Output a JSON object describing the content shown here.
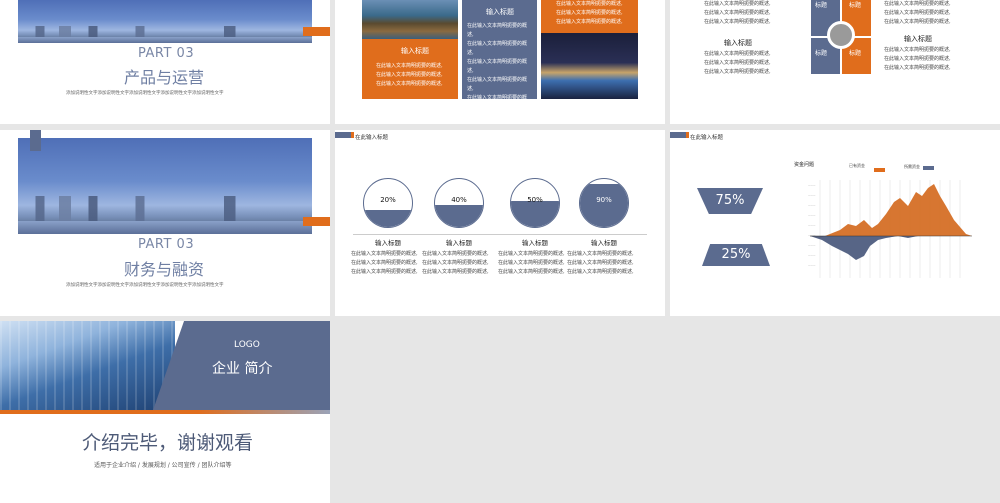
{
  "colors": {
    "navy": "#5b6b8f",
    "orange": "#e06d1c",
    "bg": "#e6e6e6"
  },
  "slide1": {
    "part": "PART 03",
    "title": "产品与运营",
    "caption": "添加说明性文字添加说明性文字添加说明性文字添加说明性文字添加说明性文字"
  },
  "slide2": {
    "box1_title": "输入标题",
    "box1_lines": [
      "在此输入文本简明扼要的概述,",
      "在此输入文本简明扼要的概述,",
      "在此输入文本简明扼要的概述,"
    ],
    "box2_title": "输入标题",
    "box2_lines": [
      "在此输入文本简明扼要的概述,",
      "在此输入文本简明扼要的概述,",
      "在此输入文本简明扼要的概述,",
      "在此输入文本简明扼要的概述,",
      "在此输入文本简明扼要的概述,",
      "在此输入文本简明扼要的概述,"
    ],
    "box3_lines": [
      "在此输入文本简明扼要的概述,",
      "在此输入文本简明扼要的概述,",
      "在此输入文本简明扼要的概述,"
    ]
  },
  "slide3": {
    "top_lines_left": [
      "在此输入文本简明扼要的概述,",
      "在此输入文本简明扼要的概述,",
      "在此输入文本简明扼要的概述,"
    ],
    "top_lines_right": [
      "在此输入文本简明扼要的概述,",
      "在此输入文本简明扼要的概述,",
      "在此输入文本简明扼要的概述,"
    ],
    "left_heading": "输入标题",
    "left_lines": [
      "在此输入文本简明扼要的概述,",
      "在此输入文本简明扼要的概述,",
      "在此输入文本简明扼要的概述,"
    ],
    "right_heading": "输入标题",
    "right_lines": [
      "在此输入文本简明扼要的概述,",
      "在此输入文本简明扼要的概述,",
      "在此输入文本简明扼要的概述,"
    ],
    "quad_labels": [
      "标题",
      "标题",
      "标题",
      "标题"
    ]
  },
  "slide4": {
    "part": "PART 03",
    "title": "财务与融资",
    "caption": "添加说明性文字添加说明性文字添加说明性文字添加说明性文字添加说明性文字"
  },
  "slide5": {
    "header": "在此输入标题",
    "items": [
      {
        "percent": "20%",
        "fill": 0.35,
        "heading": "输入标题",
        "lines": [
          "在此输入文本简明扼要的概述,",
          "在此输入文本简明扼要的概述,",
          "在此输入文本简明扼要的概述,"
        ]
      },
      {
        "percent": "40%",
        "fill": 0.45,
        "heading": "输入标题",
        "lines": [
          "在此输入文本简明扼要的概述,",
          "在此输入文本简明扼要的概述,",
          "在此输入文本简明扼要的概述,"
        ]
      },
      {
        "percent": "50%",
        "fill": 0.55,
        "heading": "输入标题",
        "lines": [
          "在此输入文本简明扼要的概述,",
          "在此输入文本简明扼要的概述,",
          "在此输入文本简明扼要的概述,"
        ]
      },
      {
        "percent": "90%",
        "fill": 0.9,
        "heading": "输入标题",
        "lines": [
          "在此输入文本简明扼要的概述,",
          "在此输入文本简明扼要的概述,",
          "在此输入文本简明扼要的概述,"
        ]
      }
    ]
  },
  "slide6": {
    "header": "在此输入标题",
    "stat1": "75%",
    "stat2": "25%",
    "chart_title": "资金问题",
    "legend1": "已有资金",
    "legend2": "所需资金"
  },
  "slide7": {
    "logo": "LOGO",
    "company": "企业  简介",
    "title": "介绍完毕，谢谢观看",
    "subtitle": "适用于企业介绍 / 发展规划 / 公司宣传 / 团队介绍等"
  }
}
